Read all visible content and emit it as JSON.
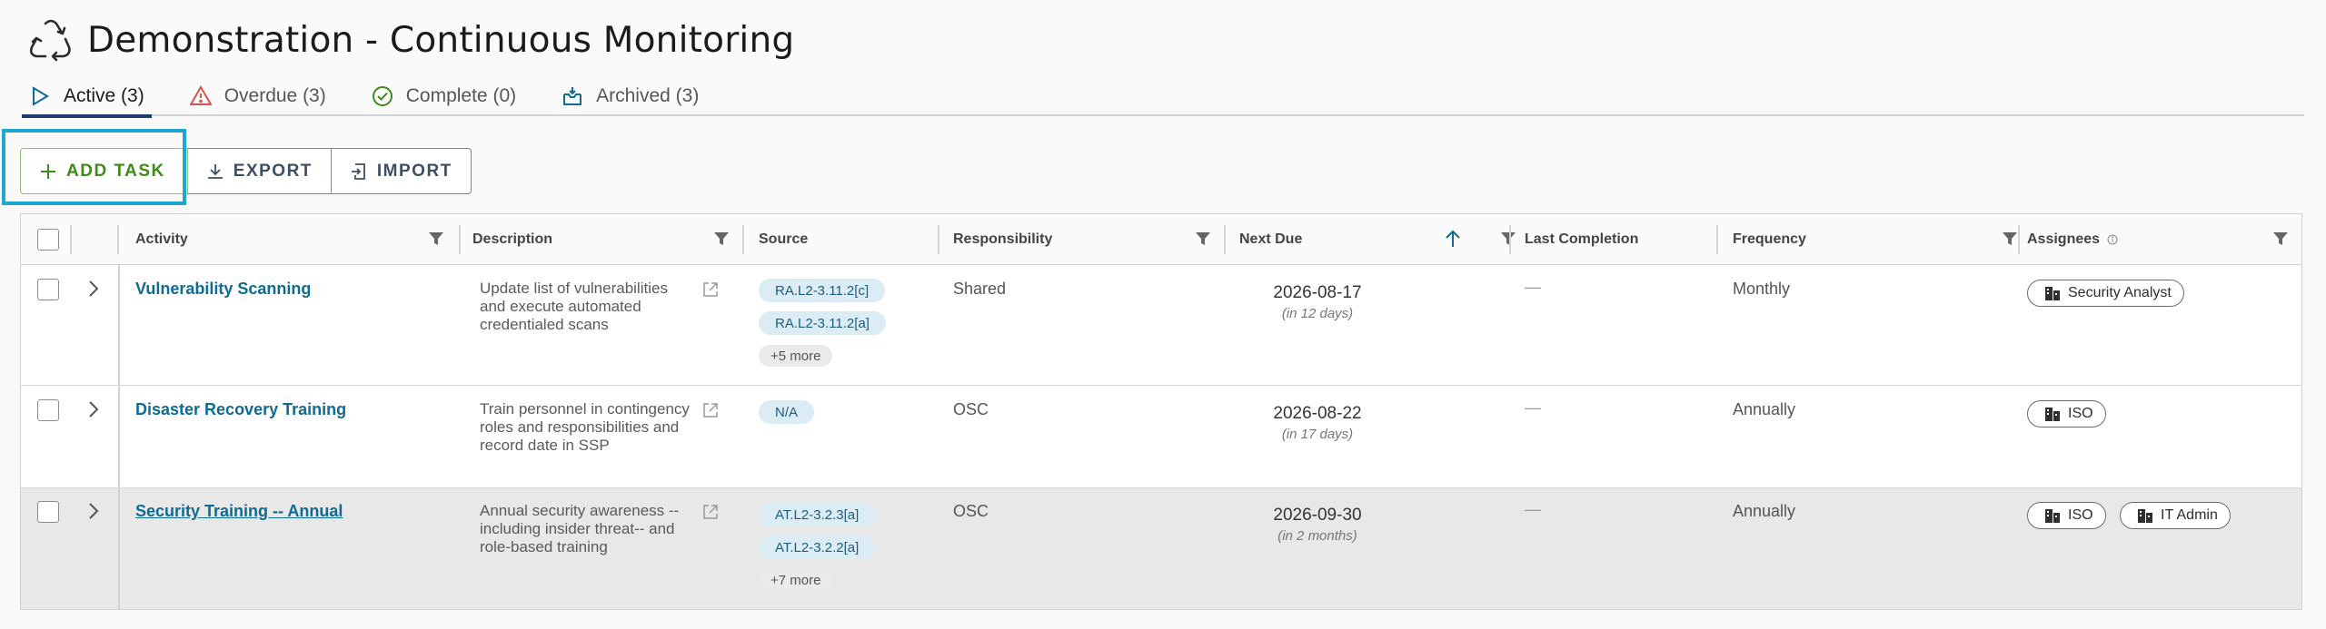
{
  "page": {
    "title": "Demonstration - Continuous Monitoring",
    "icon": "recycle-cycle-icon"
  },
  "tabs": [
    {
      "label": "Active (3)",
      "icon": "play-outline-icon",
      "active": true
    },
    {
      "label": "Overdue (3)",
      "icon": "warning-triangle-icon",
      "color": "#d9534f"
    },
    {
      "label": "Complete (0)",
      "icon": "check-circle-icon",
      "color": "#3e8b1a"
    },
    {
      "label": "Archived (3)",
      "icon": "archive-box-icon",
      "color": "#0f6a94"
    }
  ],
  "toolbar": {
    "add_label": "ADD TASK",
    "export_label": "EXPORT",
    "import_label": "IMPORT"
  },
  "columns": {
    "activity": "Activity",
    "description": "Description",
    "source": "Source",
    "responsibility": "Responsibility",
    "next_due": "Next Due",
    "last_completion": "Last Completion",
    "frequency": "Frequency",
    "assignees": "Assignees"
  },
  "rows": [
    {
      "activity": "Vulnerability Scanning",
      "description": "Update list of vulnerabilities and execute automated credentialed scans",
      "sources": [
        "RA.L2-3.11.2[c]",
        "RA.L2-3.11.2[a]"
      ],
      "more": "+5 more",
      "responsibility": "Shared",
      "next_due": "2026-08-17",
      "relative": "(in 12 days)",
      "last_completion": "—",
      "frequency": "Monthly",
      "assignees": [
        "Security Analyst"
      ]
    },
    {
      "activity": "Disaster Recovery Training",
      "description": "Train personnel in contingency roles and responsibilities and record date in SSP",
      "sources": [
        "N/A"
      ],
      "more": "",
      "responsibility": "OSC",
      "next_due": "2026-08-22",
      "relative": "(in 17 days)",
      "last_completion": "—",
      "frequency": "Annually",
      "assignees": [
        "ISO"
      ]
    },
    {
      "activity": "Security Training -- Annual",
      "description": "Annual security awareness --including insider threat-- and role-based training",
      "sources": [
        "AT.L2-3.2.3[a]",
        "AT.L2-3.2.2[a]"
      ],
      "more": "+7 more",
      "responsibility": "OSC",
      "next_due": "2026-09-30",
      "relative": "(in 2 months)",
      "last_completion": "—",
      "frequency": "Annually",
      "assignees": [
        "ISO",
        "IT Admin"
      ]
    }
  ],
  "colors": {
    "link": "#0f6a94",
    "accent_green": "#3e8b1a",
    "focus": "#1ea7cf",
    "pill_bg": "#dcecf4"
  }
}
